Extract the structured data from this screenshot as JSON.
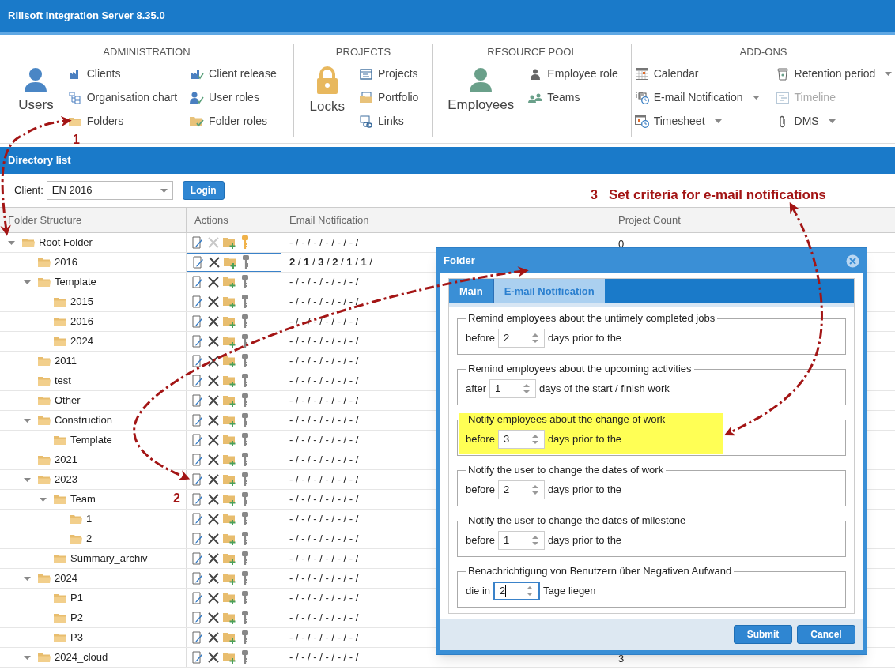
{
  "window": {
    "title": "Rillsoft Integration Server 8.35.0"
  },
  "ribbon": [
    {
      "heading": "ADMINISTRATION",
      "big_item": {
        "label": "Users"
      },
      "columns": [
        [
          {
            "label": "Clients"
          },
          {
            "label": "Organisation chart"
          },
          {
            "label": "Folders"
          }
        ],
        [
          {
            "label": "Client release"
          },
          {
            "label": "User roles"
          },
          {
            "label": "Folder roles"
          }
        ]
      ]
    },
    {
      "heading": "PROJECTS",
      "big_item": {
        "label": "Locks"
      },
      "columns": [
        [
          {
            "label": "Projects"
          },
          {
            "label": "Portfolio"
          },
          {
            "label": "Links"
          }
        ]
      ]
    },
    {
      "heading": "RESOURCE POOL",
      "big_item": {
        "label": "Employees"
      },
      "columns": [
        [
          {
            "label": "Employee role"
          },
          {
            "label": "Teams"
          }
        ]
      ]
    },
    {
      "heading": "ADD-ONS",
      "columns": [
        [
          {
            "label": "Calendar",
            "dropdown": false,
            "disabled": false
          },
          {
            "label": "E-mail Notification",
            "dropdown": true,
            "disabled": false
          },
          {
            "label": "Timesheet",
            "dropdown": true,
            "disabled": false
          }
        ],
        [
          {
            "label": "Retention period",
            "dropdown": true,
            "disabled": false
          },
          {
            "label": "Timeline",
            "dropdown": false,
            "disabled": true
          },
          {
            "label": "DMS",
            "dropdown": true,
            "disabled": false
          }
        ]
      ]
    }
  ],
  "panel": {
    "title": "Directory list",
    "client_label": "Client:",
    "client_value": "EN 2016",
    "login_button": "Login"
  },
  "table": {
    "columns": [
      "Folder Structure",
      "Actions",
      "Email Notification",
      "Project Count"
    ],
    "rows": [
      {
        "name": "Root Folder",
        "expanded": true,
        "selected": false,
        "delete_enabled": false,
        "key_active": true,
        "email": "- / - / - / - / - / - /",
        "project_count": "0",
        "children": [
          {
            "name": "2016",
            "selected": true,
            "delete_enabled": true,
            "key_active": false,
            "email": "**2** / **1** / **3** / **2** / **1** / **1** /"
          },
          {
            "name": "Template",
            "expanded": true,
            "selected": false,
            "delete_enabled": true,
            "key_active": false,
            "email": "- / - / - / - / - / - /",
            "children": [
              {
                "name": "2015",
                "selected": false,
                "delete_enabled": true,
                "key_active": false,
                "email": "- / - / - / - / - / - /"
              },
              {
                "name": "2016",
                "selected": false,
                "delete_enabled": true,
                "key_active": false,
                "email": "- / - / - / - / - / - /"
              },
              {
                "name": "2024",
                "selected": false,
                "delete_enabled": true,
                "key_active": false,
                "email": "- / - / - / - / - / - /"
              }
            ]
          },
          {
            "name": "2011",
            "selected": false,
            "delete_enabled": true,
            "key_active": false,
            "email": "- / - / - / - / - / - /"
          },
          {
            "name": "test",
            "selected": false,
            "delete_enabled": true,
            "key_active": false,
            "email": "- / - / - / - / - / - /"
          },
          {
            "name": "Other",
            "selected": false,
            "delete_enabled": true,
            "key_active": false,
            "email": "- / - / - / - / - / - /"
          },
          {
            "name": "Construction",
            "expanded": true,
            "selected": false,
            "delete_enabled": true,
            "key_active": false,
            "email": "- / - / - / - / - / - /",
            "children": [
              {
                "name": "Template",
                "selected": false,
                "delete_enabled": true,
                "key_active": false,
                "email": "- / - / - / - / - / - /"
              }
            ]
          },
          {
            "name": "2021",
            "selected": false,
            "delete_enabled": true,
            "key_active": false,
            "email": "- / - / - / - / - / - /"
          },
          {
            "name": "2023",
            "expanded": true,
            "selected": false,
            "delete_enabled": true,
            "key_active": false,
            "email": "- / - / - / - / - / - /",
            "children": [
              {
                "name": "Team",
                "expanded": true,
                "selected": false,
                "delete_enabled": true,
                "key_active": false,
                "email": "- / - / - / - / - / - /",
                "children": [
                  {
                    "name": "1",
                    "selected": false,
                    "delete_enabled": true,
                    "key_active": false,
                    "email": "- / - / - / - / - / - /"
                  },
                  {
                    "name": "2",
                    "selected": false,
                    "delete_enabled": true,
                    "key_active": false,
                    "email": "- / - / - / - / - / - /"
                  }
                ]
              },
              {
                "name": "Summary_archiv",
                "selected": false,
                "delete_enabled": true,
                "key_active": false,
                "email": "- / - / - / - / - / - /"
              }
            ]
          },
          {
            "name": "2024",
            "expanded": true,
            "selected": false,
            "delete_enabled": true,
            "key_active": false,
            "email": "- / - / - / - / - / - /",
            "children": [
              {
                "name": "P1",
                "selected": false,
                "delete_enabled": true,
                "key_active": false,
                "email": "- / - / - / - / - / - /"
              },
              {
                "name": "P2",
                "selected": false,
                "delete_enabled": true,
                "key_active": false,
                "email": "- / - / - / - / - / - /"
              },
              {
                "name": "P3",
                "selected": false,
                "delete_enabled": true,
                "key_active": false,
                "email": "- / - / - / - / - / - /"
              }
            ]
          },
          {
            "name": "2024_cloud",
            "expanded": true,
            "selected": false,
            "delete_enabled": true,
            "key_active": false,
            "email": "- / - / - / - / - / - /",
            "project_count": "3"
          }
        ]
      }
    ]
  },
  "dialog": {
    "title": "Folder",
    "tabs": [
      {
        "label": "Main",
        "selected": false
      },
      {
        "label": "E-mail Notification",
        "selected": true
      }
    ],
    "fieldsets": [
      {
        "legend": "Remind employees about the untimely completed jobs",
        "prefix": "before",
        "value": "2",
        "suffix": "days prior to the",
        "highlighted": false,
        "focused": false
      },
      {
        "legend": "Remind employees about the upcoming activities",
        "prefix": "after",
        "value": "1",
        "suffix": "days of the start / finish work",
        "highlighted": false,
        "focused": false
      },
      {
        "legend": "Notify employees about the change of work",
        "prefix": "before",
        "value": "3",
        "suffix": "days prior to the",
        "highlighted": true,
        "focused": false
      },
      {
        "legend": "Notify the user to change the dates of work",
        "prefix": "before",
        "value": "2",
        "suffix": "days prior to the",
        "highlighted": false,
        "focused": false
      },
      {
        "legend": "Notify the user to change the dates of milestone",
        "prefix": "before",
        "value": "1",
        "suffix": "days prior to the",
        "highlighted": false,
        "focused": false
      },
      {
        "legend": "Benachrichtigung von Benutzern über Negativen Aufwand",
        "prefix": "die in",
        "value": "2",
        "suffix": "Tage liegen",
        "highlighted": false,
        "focused": true
      }
    ],
    "buttons": [
      "Submit",
      "Cancel"
    ]
  },
  "annotations": [
    {
      "label": "1"
    },
    {
      "label": "2"
    },
    {
      "label": "3",
      "text": "Set criteria for e-mail notifications"
    }
  ]
}
